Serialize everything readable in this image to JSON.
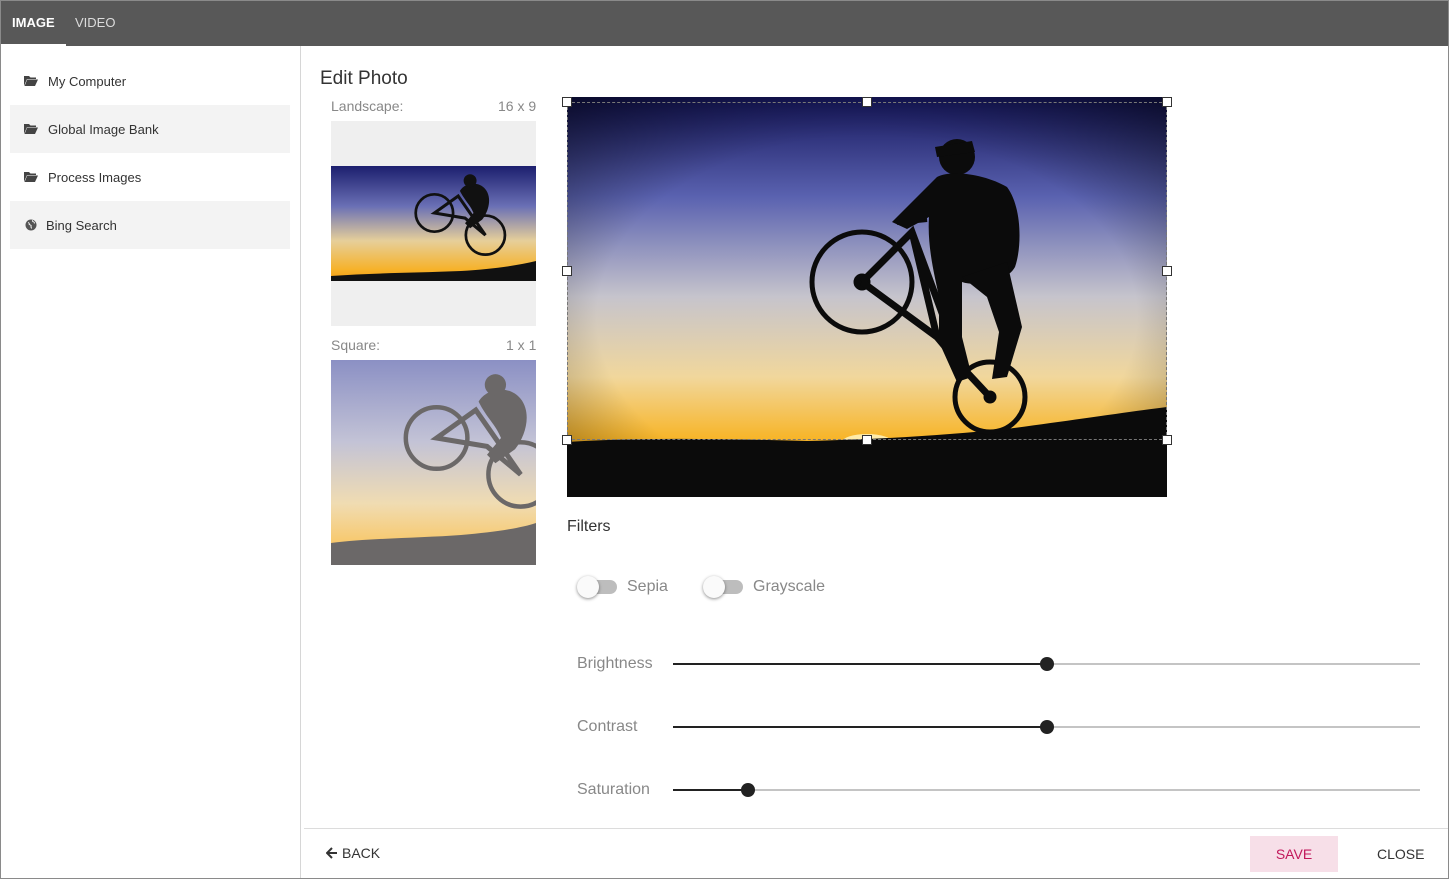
{
  "tabs": [
    {
      "label": "IMAGE",
      "active": true
    },
    {
      "label": "VIDEO",
      "active": false
    }
  ],
  "sidebar": {
    "items": [
      {
        "label": "My Computer",
        "icon": "folder-icon"
      },
      {
        "label": "Global Image Bank",
        "icon": "folder-icon"
      },
      {
        "label": "Process Images",
        "icon": "folder-icon"
      },
      {
        "label": "Bing Search",
        "icon": "globe-icon"
      }
    ]
  },
  "editor": {
    "title": "Edit Photo",
    "crops": [
      {
        "label": "Landscape:",
        "ratio": "16 x 9"
      },
      {
        "label": "Square:",
        "ratio": "1 x 1"
      }
    ],
    "filters_title": "Filters",
    "toggles": [
      {
        "label": "Sepia",
        "on": false
      },
      {
        "label": "Grayscale",
        "on": false
      }
    ],
    "sliders": [
      {
        "label": "Brightness",
        "value": 0.5
      },
      {
        "label": "Contrast",
        "value": 0.5
      },
      {
        "label": "Saturation",
        "value": 0.1
      }
    ]
  },
  "footer": {
    "back_label": "BACK",
    "save_label": "SAVE",
    "close_label": "CLOSE"
  },
  "colors": {
    "topbar": "#585858",
    "save_bg": "#f7dfe8",
    "save_text": "#c2185b"
  }
}
